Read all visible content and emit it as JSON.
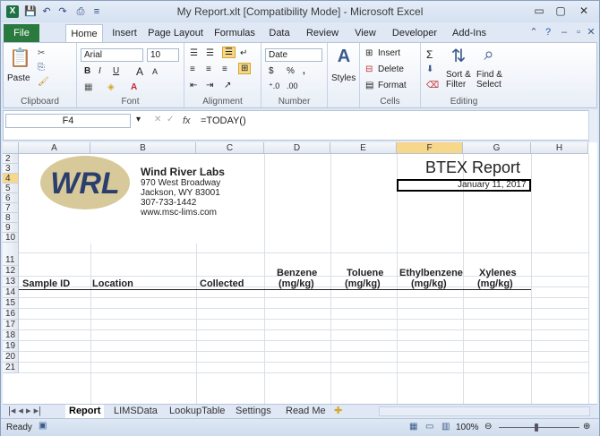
{
  "window": {
    "title": "My Report.xlt  [Compatibility Mode]  -  Microsoft Excel",
    "app_icon": "X"
  },
  "qat": {
    "save": "💾",
    "undo": "↶",
    "redo": "↷",
    "preview": "⎙",
    "more": "≡"
  },
  "window_controls": {
    "minimize": "▭",
    "restore": "▢",
    "close": "✕"
  },
  "ribbon_tabs": [
    {
      "label": "File"
    },
    {
      "label": "Home"
    },
    {
      "label": "Insert"
    },
    {
      "label": "Page Layout"
    },
    {
      "label": "Formulas"
    },
    {
      "label": "Data"
    },
    {
      "label": "Review"
    },
    {
      "label": "View"
    },
    {
      "label": "Developer"
    },
    {
      "label": "Add-Ins"
    }
  ],
  "ribbon": {
    "clipboard": {
      "label": "Clipboard",
      "paste": "Paste"
    },
    "font": {
      "label": "Font",
      "name": "Arial",
      "size": "10",
      "bold": "B",
      "italic": "I",
      "underline": "U",
      "grow": "A",
      "shrink": "A"
    },
    "alignment": {
      "label": "Alignment"
    },
    "number": {
      "label": "Number",
      "format": "Date",
      "currency": "$",
      "percent": "%",
      "comma": ","
    },
    "styles": {
      "label": "Styles"
    },
    "cells": {
      "label": "Cells",
      "insert": "Insert",
      "delete": "Delete",
      "format": "Format"
    },
    "editing": {
      "label": "Editing",
      "sort": "Sort &",
      "filter": "Filter",
      "find": "Find &",
      "select": "Select"
    }
  },
  "formula_bar": {
    "name_box": "F4",
    "fx": "fx",
    "formula": "=TODAY()"
  },
  "columns": [
    "A",
    "B",
    "C",
    "D",
    "E",
    "F",
    "G",
    "H"
  ],
  "rows": [
    "2",
    "3",
    "4",
    "5",
    "6",
    "7",
    "8",
    "9",
    "10",
    "11",
    "12",
    "13",
    "14",
    "15",
    "16",
    "17",
    "18",
    "19",
    "20",
    "21"
  ],
  "company": {
    "name": "Wind River Labs",
    "address1": "970 West Broadway",
    "address2": "Jackson, WY 83001",
    "phone": "307-733-1442",
    "web": "www.msc-lims.com",
    "logo_text": "WRL"
  },
  "report": {
    "title": "BTEX Report",
    "date": "January 11, 2017"
  },
  "headers": {
    "sample_id": "Sample ID",
    "location": "Location",
    "collected": "Collected",
    "benzene": "Benzene",
    "toluene": "Toluene",
    "ethylbenzene": "Ethylbenzene",
    "xylenes": "Xylenes",
    "unit": "(mg/kg)"
  },
  "sheet_tabs": [
    {
      "label": "Report"
    },
    {
      "label": "LIMSData"
    },
    {
      "label": "LookupTable"
    },
    {
      "label": "Settings"
    },
    {
      "label": "Read Me"
    }
  ],
  "status": {
    "ready": "Ready",
    "zoom": "100%"
  }
}
